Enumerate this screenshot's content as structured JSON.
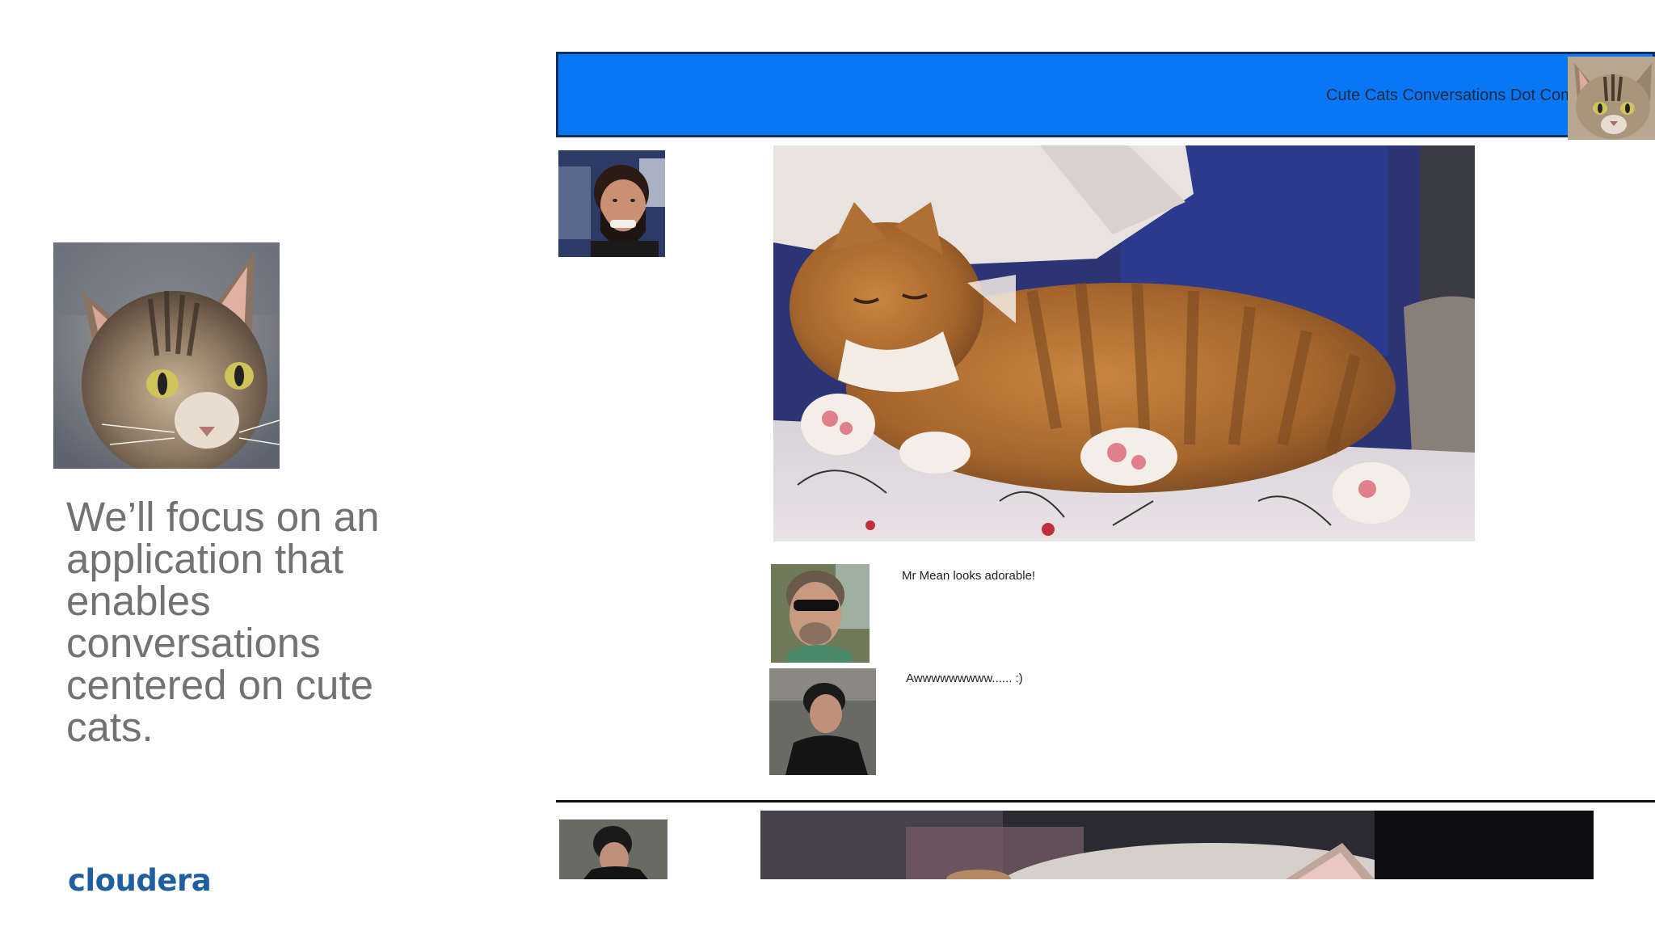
{
  "slide": {
    "caption": "We’ll focus on an application that enables conversations centered on cute cats.",
    "logo_text": "cloudera"
  },
  "app": {
    "title": "Cute Cats Conversations Dot Com",
    "header_color": "#0877f6",
    "comments": [
      {
        "text": "Mr Mean looks adorable!"
      },
      {
        "text": "Awwwwwwwww...... :)"
      }
    ]
  },
  "colors": {
    "caption_text": "#727272",
    "logo": "#1f5fa0",
    "header_border": "#0b2f63"
  },
  "icons": {
    "left_image": "tabby-cat-portrait",
    "post_image": "sleeping-orange-cat",
    "header_avatar": "cat-avatar"
  }
}
